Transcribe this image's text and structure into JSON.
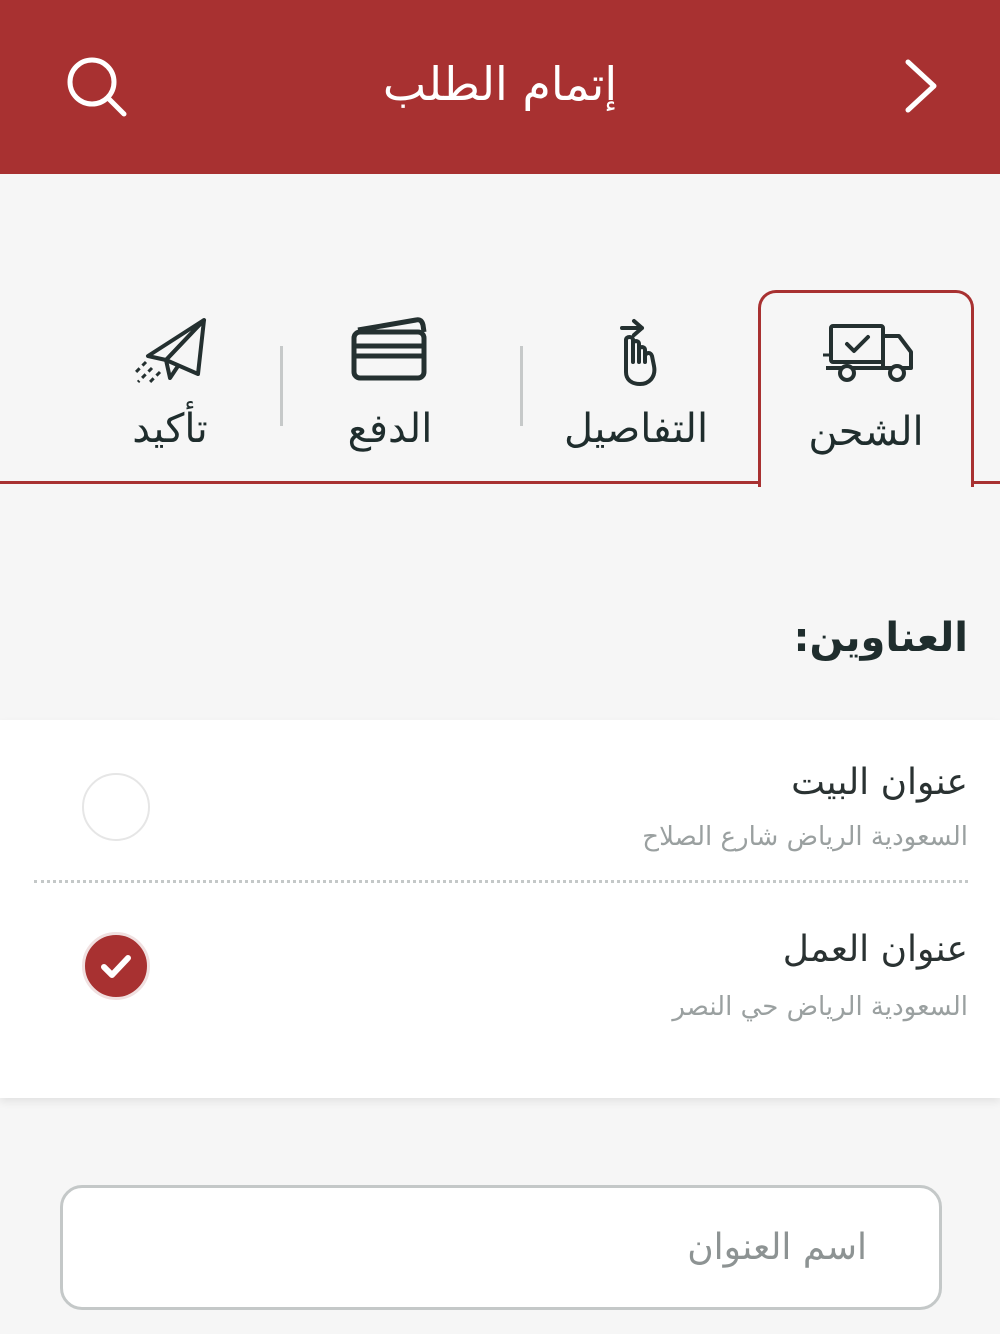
{
  "header": {
    "title": "إتمام الطلب",
    "color": "#a83131"
  },
  "steps": [
    {
      "label": "الشحن",
      "icon": "truck-icon",
      "active": true
    },
    {
      "label": "التفاصيل",
      "icon": "tap-gesture-icon",
      "active": false
    },
    {
      "label": "الدفع",
      "icon": "credit-card-icon",
      "active": false
    },
    {
      "label": "تأكيد",
      "icon": "paper-plane-icon",
      "active": false
    }
  ],
  "addresses": {
    "title": "العناوين:",
    "items": [
      {
        "name": "عنوان البيت",
        "detail": "السعودية الرياض شارع الصلاح",
        "selected": false
      },
      {
        "name": "عنوان العمل",
        "detail": "السعودية الرياض حي النصر",
        "selected": true
      }
    ]
  },
  "address_name_input": {
    "placeholder": "اسم العنوان",
    "value": ""
  }
}
